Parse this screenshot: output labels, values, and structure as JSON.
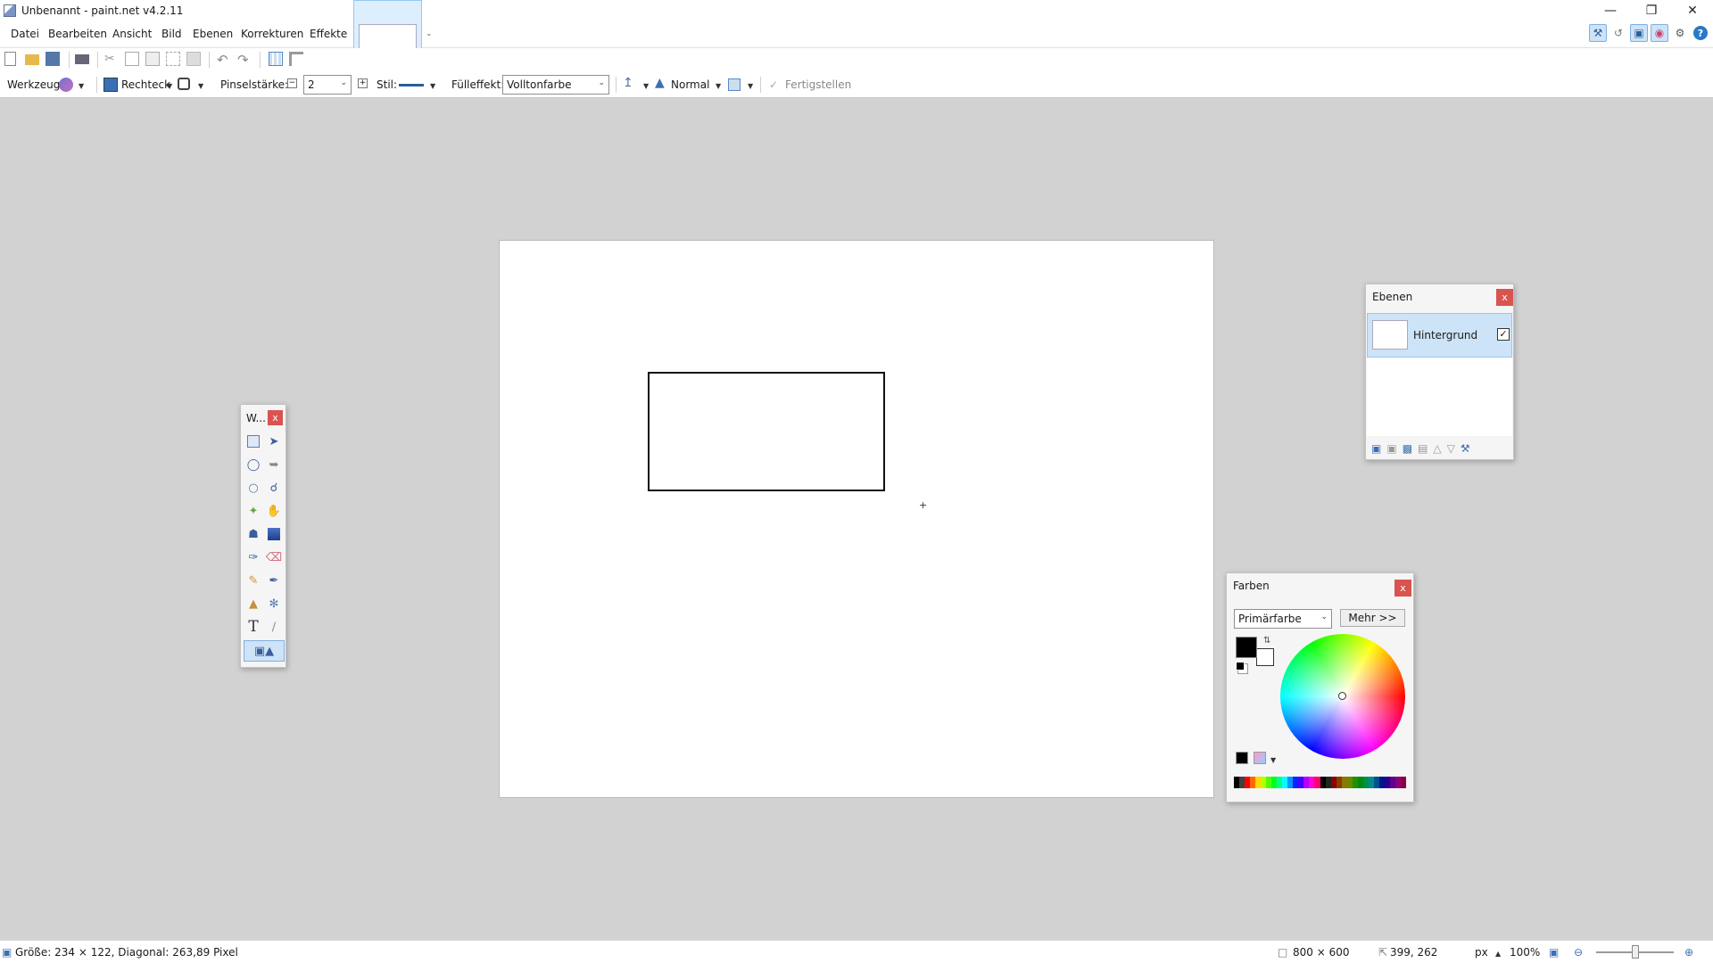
{
  "window": {
    "title": "Unbenannt - paint.net v4.2.11"
  },
  "menu": [
    "Datei",
    "Bearbeiten",
    "Ansicht",
    "Bild",
    "Ebenen",
    "Korrekturen",
    "Effekte"
  ],
  "toolbar": {
    "tool_label": "Werkzeug:",
    "shape_type": "Rechteck",
    "brush_label": "Pinselstärke:",
    "brush_value": "2",
    "style_label": "Stil:",
    "fill_label": "Fülleffekt:",
    "fill_value": "Volltonfarbe",
    "blend_mode": "Normal",
    "finish_label": "Fertigstellen"
  },
  "tools_panel": {
    "title": "W..."
  },
  "layers_panel": {
    "title": "Ebenen",
    "layers": [
      {
        "name": "Hintergrund",
        "visible": true
      }
    ]
  },
  "colors_panel": {
    "title": "Farben",
    "mode": "Primärfarbe",
    "more_button": "Mehr >>",
    "primary": "#000000",
    "secondary": "#ffffff",
    "palette": [
      "#000000",
      "#404040",
      "#ff0000",
      "#ff6a00",
      "#ffd800",
      "#b6ff00",
      "#4cff00",
      "#00ff21",
      "#00ff90",
      "#00ffff",
      "#0094ff",
      "#0026ff",
      "#4800ff",
      "#b200ff",
      "#ff00dc",
      "#ff006e"
    ]
  },
  "status": {
    "size_info": "Größe: 234 × 122, Diagonal: 263,89 Pixel",
    "image_size": "800 × 600",
    "cursor_pos": "399, 262",
    "unit": "px",
    "zoom": "100%"
  }
}
